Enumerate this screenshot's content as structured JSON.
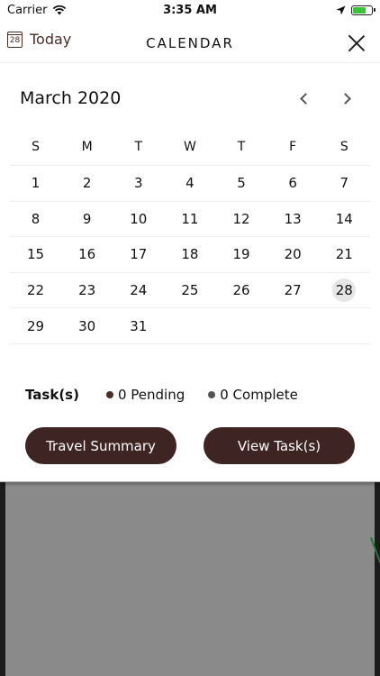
{
  "status_bar": {
    "carrier": "Carrier",
    "time": "3:35 AM"
  },
  "header": {
    "today_icon_day": "28",
    "today_label": "Today",
    "title": "CALENDAR"
  },
  "calendar": {
    "month_label": "March 2020",
    "weekdays": [
      "S",
      "M",
      "T",
      "W",
      "T",
      "F",
      "S"
    ],
    "weeks": [
      [
        "1",
        "2",
        "3",
        "4",
        "5",
        "6",
        "7"
      ],
      [
        "8",
        "9",
        "10",
        "11",
        "12",
        "13",
        "14"
      ],
      [
        "15",
        "16",
        "17",
        "18",
        "19",
        "20",
        "21"
      ],
      [
        "22",
        "23",
        "24",
        "25",
        "26",
        "27",
        "28"
      ],
      [
        "29",
        "30",
        "31",
        "",
        "",
        "",
        ""
      ]
    ],
    "selected_day": "28"
  },
  "tasks": {
    "label": "Task(s)",
    "pending": "0 Pending",
    "complete": "0 Complete",
    "pending_color": "#4a2c24",
    "complete_color": "#555555"
  },
  "buttons": {
    "travel_summary": "Travel Summary",
    "view_tasks": "View Task(s)"
  },
  "colors": {
    "accent": "#3e2422",
    "battery": "#3ac43a"
  }
}
